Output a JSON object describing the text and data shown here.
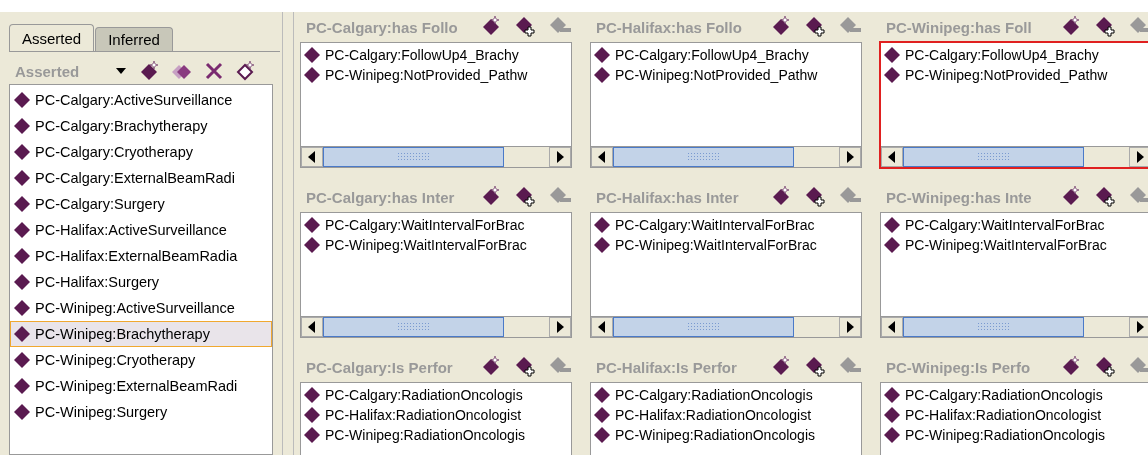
{
  "tabs": [
    {
      "label": "Asserted",
      "selected": true
    },
    {
      "label": "Inferred",
      "selected": false
    }
  ],
  "hierarchy": {
    "title": "Asserted",
    "items": [
      {
        "label": "PC-Calgary:ActiveSurveillance",
        "selected": false
      },
      {
        "label": "PC-Calgary:Brachytherapy",
        "selected": false
      },
      {
        "label": "PC-Calgary:Cryotherapy",
        "selected": false
      },
      {
        "label": "PC-Calgary:ExternalBeamRadi",
        "selected": false
      },
      {
        "label": "PC-Calgary:Surgery",
        "selected": false
      },
      {
        "label": "PC-Halifax:ActiveSurveillance",
        "selected": false
      },
      {
        "label": "PC-Halifax:ExternalBeamRadia",
        "selected": false
      },
      {
        "label": "PC-Halifax:Surgery",
        "selected": false
      },
      {
        "label": "PC-Winipeg:ActiveSurveillance",
        "selected": false
      },
      {
        "label": "PC-Winipeg:Brachytherapy",
        "selected": true
      },
      {
        "label": "PC-Winipeg:Cryotherapy",
        "selected": false
      },
      {
        "label": "PC-Winipeg:ExternalBeamRadi",
        "selected": false
      },
      {
        "label": "PC-Winipeg:Surgery",
        "selected": false
      }
    ]
  },
  "panels": [
    {
      "title": "PC-Calgary:has Follo",
      "selected": false,
      "items": [
        "PC-Calgary:FollowUp4_Brachy",
        "PC-Winipeg:NotProvided_Pathw"
      ]
    },
    {
      "title": "PC-Halifax:has Follo",
      "selected": false,
      "items": [
        "PC-Calgary:FollowUp4_Brachy",
        "PC-Winipeg:NotProvided_Pathw"
      ]
    },
    {
      "title": "PC-Winipeg:has Foll",
      "selected": true,
      "items": [
        "PC-Calgary:FollowUp4_Brachy",
        "PC-Winipeg:NotProvided_Pathw"
      ]
    },
    {
      "title": "PC-Calgary:has Inter",
      "selected": false,
      "items": [
        "PC-Calgary:WaitIntervalForBrac",
        "PC-Winipeg:WaitIntervalForBrac"
      ]
    },
    {
      "title": "PC-Halifax:has Inter",
      "selected": false,
      "items": [
        "PC-Calgary:WaitIntervalForBrac",
        "PC-Winipeg:WaitIntervalForBrac"
      ]
    },
    {
      "title": "PC-Winipeg:has Inte",
      "selected": false,
      "items": [
        "PC-Calgary:WaitIntervalForBrac",
        "PC-Winipeg:WaitIntervalForBrac"
      ]
    },
    {
      "title": "PC-Calgary:Is Perfor",
      "selected": false,
      "items": [
        "PC-Calgary:RadiationOncologis",
        "PC-Halifax:RadiationOncologist",
        "PC-Winipeg:RadiationOncologis"
      ]
    },
    {
      "title": "PC-Halifax:Is Perfor",
      "selected": false,
      "items": [
        "PC-Calgary:RadiationOncologis",
        "PC-Halifax:RadiationOncologist",
        "PC-Winipeg:RadiationOncologis"
      ]
    },
    {
      "title": "PC-Winipeg:Is Perfo",
      "selected": false,
      "items": [
        "PC-Calgary:RadiationOncologis",
        "PC-Halifax:RadiationOncologist",
        "PC-Winipeg:RadiationOncologis"
      ]
    }
  ]
}
